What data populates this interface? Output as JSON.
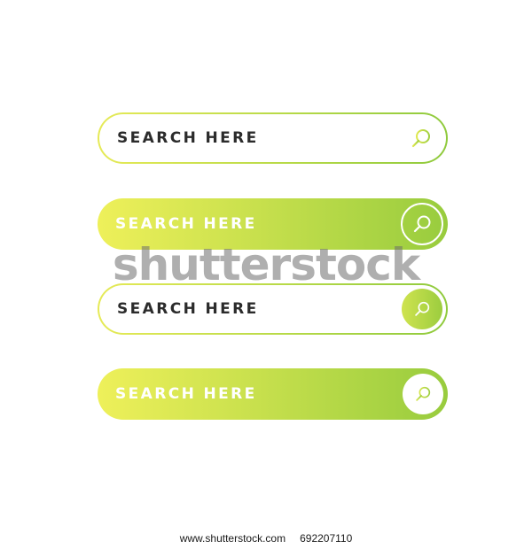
{
  "search_bars": [
    {
      "style": "outline",
      "text": "SEARCH HERE",
      "button_style": "plain-icon",
      "icon": "search-icon"
    },
    {
      "style": "filled",
      "text": "SEARCH HERE",
      "button_style": "white-ring",
      "icon": "search-icon"
    },
    {
      "style": "outline",
      "text": "SEARCH HERE",
      "button_style": "filled-circle",
      "icon": "search-icon"
    },
    {
      "style": "filled",
      "text": "SEARCH HERE",
      "button_style": "white-circle",
      "icon": "search-icon"
    }
  ],
  "colors": {
    "gradient_start": "#eef05a",
    "gradient_end": "#98cc3e",
    "outline_text": "#2b2b2b",
    "filled_text": "#ffffff"
  },
  "watermark": "shutterstock",
  "footer": {
    "site": "www.shutterstock.com",
    "id": "692207110"
  }
}
